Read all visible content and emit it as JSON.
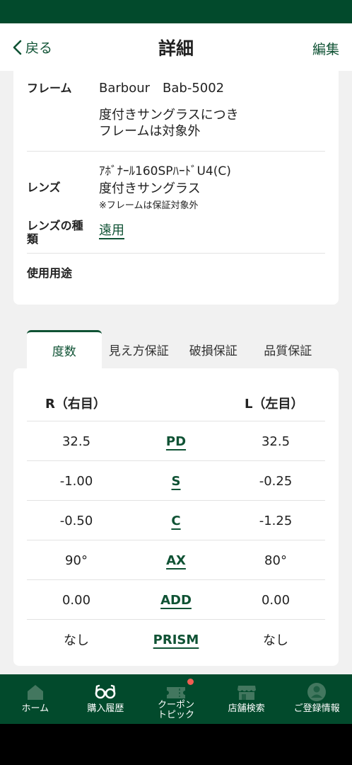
{
  "header": {
    "back_label": "戻る",
    "title": "詳細",
    "edit_label": "編集"
  },
  "info": {
    "frame_label": "フレーム",
    "frame_value": "Barbour　Bab-5002",
    "frame_note_1": "度付きサングラスにつき",
    "frame_note_2": "フレームは対象外",
    "lens_label": "レンズ",
    "lens_name": "ｱﾎﾞﾅｰﾙ160SPﾊｰﾄﾞU4(C)",
    "lens_type_value": "度付きサングラス",
    "lens_note": "※フレームは保証対象外",
    "lens_kind_label_1": "レンズの種",
    "lens_kind_label_2": "類",
    "lens_kind_value": "遠用",
    "usage_label": "使用用途"
  },
  "tabs": [
    "度数",
    "見え方保証",
    "破損保証",
    "品質保証"
  ],
  "rx": {
    "right_header": "R（右目）",
    "left_header": "L（左目）",
    "rows": [
      {
        "label": "PD",
        "right": "32.5",
        "left": "32.5"
      },
      {
        "label": "S",
        "right": "-1.00",
        "left": "-0.25"
      },
      {
        "label": "C",
        "right": "-0.50",
        "left": "-1.25"
      },
      {
        "label": "AX",
        "right": "90°",
        "left": "80°"
      },
      {
        "label": "ADD",
        "right": "0.00",
        "left": "0.00"
      },
      {
        "label": "PRISM",
        "right": "なし",
        "left": "なし"
      }
    ]
  },
  "nav": [
    {
      "label": "ホーム",
      "icon": "home-icon"
    },
    {
      "label": "購入履歴",
      "icon": "glasses-icon"
    },
    {
      "label": "クーポン\nトピック",
      "icon": "ticket-icon"
    },
    {
      "label": "店舗検索",
      "icon": "store-icon"
    },
    {
      "label": "ご登録情報",
      "icon": "user-icon"
    }
  ],
  "colors": {
    "brand_green": "#024a2c",
    "accent_green": "#0f5234",
    "badge_red": "#f25d52"
  }
}
